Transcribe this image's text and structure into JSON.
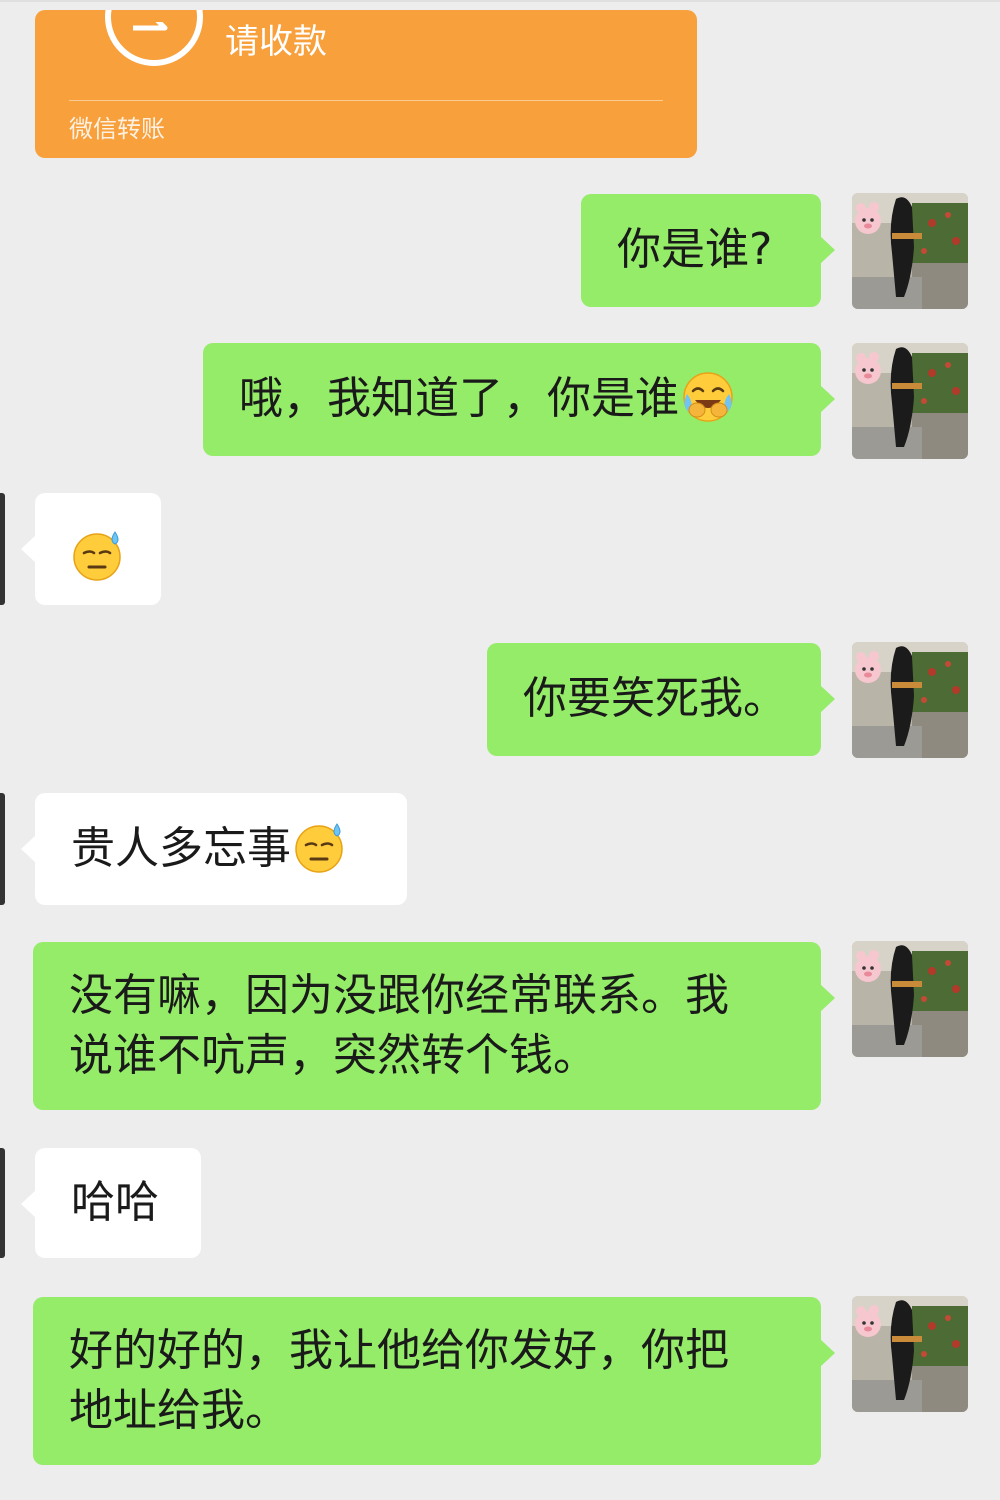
{
  "transfer": {
    "title": "请收款",
    "footer": "微信转账",
    "icon": "transfer-arrow-icon",
    "color": "#f7a03c"
  },
  "colors": {
    "sent_bubble": "#95ec69",
    "received_bubble": "#ffffff",
    "background": "#ededed"
  },
  "messages": [
    {
      "side": "sent",
      "text": "你是谁?",
      "emoji": ""
    },
    {
      "side": "sent",
      "text": "哦，我知道了，你是谁",
      "emoji": "laughing-crying-emoji"
    },
    {
      "side": "received",
      "text": "",
      "emoji": "sweat-emoji"
    },
    {
      "side": "sent",
      "text": "你要笑死我。",
      "emoji": ""
    },
    {
      "side": "received",
      "text": "贵人多忘事",
      "emoji": "sweat-emoji"
    },
    {
      "side": "sent",
      "line1": "没有嘛，因为没跟你经常联系。我",
      "line2": "说谁不吭声，突然转个钱。"
    },
    {
      "side": "received",
      "text": "哈哈",
      "emoji": ""
    },
    {
      "side": "sent",
      "line1": "好的好的，我让他给你发好，你把",
      "line2": "地址给我。"
    }
  ]
}
